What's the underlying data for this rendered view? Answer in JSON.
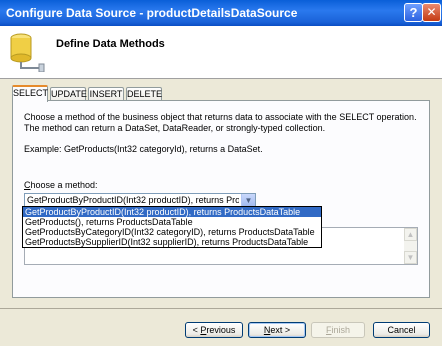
{
  "window": {
    "title": "Configure Data Source - productDetailsDataSource",
    "help_label": "?",
    "close_label": "✕"
  },
  "header": {
    "title": "Define Data Methods",
    "icon": "database-icon"
  },
  "tabs": [
    {
      "label": "SELECT",
      "active": true
    },
    {
      "label": "UPDATE",
      "active": false
    },
    {
      "label": "INSERT",
      "active": false
    },
    {
      "label": "DELETE",
      "active": false
    }
  ],
  "panel": {
    "description": "Choose a method of the business object that returns data to associate with the SELECT operation. The method can return a DataSet, DataReader, or strongly-typed collection.",
    "example": "Example: GetProducts(Int32 categoryId), returns a DataSet.",
    "choose_label_accel": "C",
    "choose_label_rest": "hoose a method:",
    "selected_method": "GetProductByProductID(Int32 productID), returns ProductsDataTable",
    "options": [
      "GetProductByProductID(Int32 productID), returns ProductsDataTable",
      "GetProducts(), returns ProductsDataTable",
      "GetProductsByCategoryID(Int32 categoryID), returns ProductsDataTable",
      "GetProductsBySupplierID(Int32 supplierID), returns ProductsDataTable"
    ]
  },
  "buttons": {
    "previous_pre": "< ",
    "previous_accel": "P",
    "previous_rest": "revious",
    "next_accel": "N",
    "next_rest": "ext >",
    "finish_accel": "F",
    "finish_rest": "inish",
    "cancel": "Cancel"
  },
  "colors": {
    "titlebar": "#0a5fd8",
    "selection": "#316ac5",
    "active_tab_accent": "#e68b2c"
  }
}
